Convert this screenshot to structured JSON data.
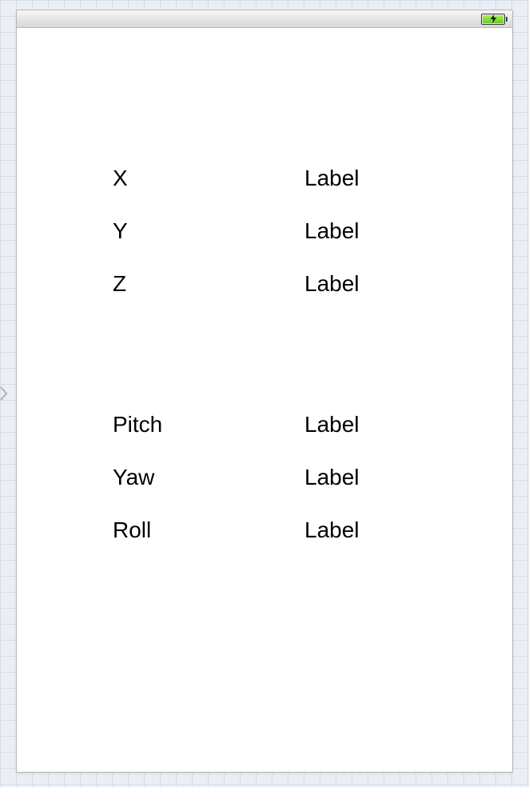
{
  "statusbar": {
    "battery_icon": "battery-charging-icon"
  },
  "rows": {
    "x": {
      "label": "X",
      "value": "Label"
    },
    "y": {
      "label": "Y",
      "value": "Label"
    },
    "z": {
      "label": "Z",
      "value": "Label"
    },
    "pitch": {
      "label": "Pitch",
      "value": "Label"
    },
    "yaw": {
      "label": "Yaw",
      "value": "Label"
    },
    "roll": {
      "label": "Roll",
      "value": "Label"
    }
  }
}
